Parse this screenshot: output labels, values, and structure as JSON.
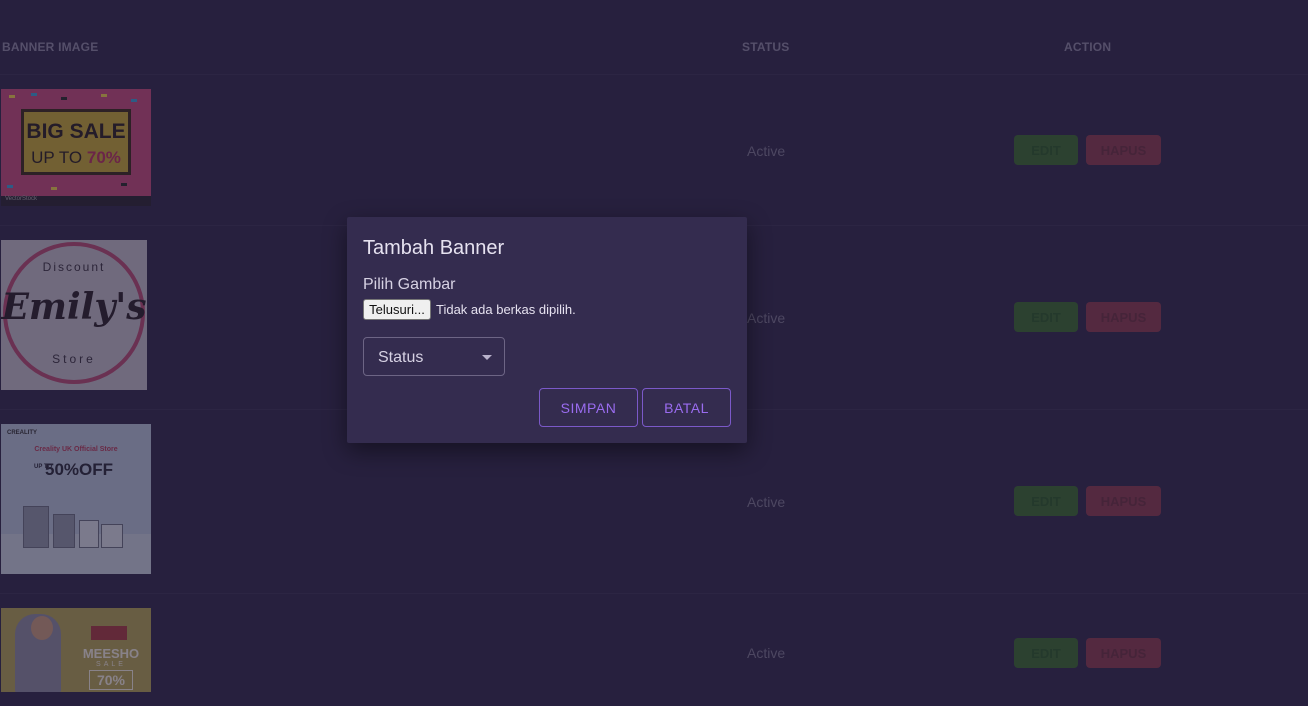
{
  "table": {
    "headers": {
      "image": "BANNER IMAGE",
      "status": "STATUS",
      "action": "ACTION"
    },
    "rows": [
      {
        "status": "Active",
        "edit_label": "EDIT",
        "delete_label": "HAPUS",
        "banner": {
          "title": "BIG SALE",
          "subtitle": "UP TO",
          "discount": "70%",
          "footer": "VectorStock"
        }
      },
      {
        "status": "Active",
        "edit_label": "EDIT",
        "delete_label": "HAPUS",
        "banner": {
          "top": "Discount",
          "name": "Emily's",
          "bottom": "Store"
        }
      },
      {
        "status": "Active",
        "edit_label": "EDIT",
        "delete_label": "HAPUS",
        "banner": {
          "brand": "CREALITY",
          "headline": "Creality UK Official Store",
          "discount": "50%OFF",
          "upto": "UP TO"
        }
      },
      {
        "status": "Active",
        "edit_label": "EDIT",
        "delete_label": "HAPUS",
        "banner": {
          "brand": "MEESHO",
          "sale": "SALE",
          "discount": "70%"
        }
      }
    ]
  },
  "dialog": {
    "title": "Tambah Banner",
    "image_label": "Pilih Gambar",
    "file_button": "Telusuri...",
    "file_status": "Tidak ada berkas dipilih.",
    "status_select": "Status",
    "save_label": "SIMPAN",
    "cancel_label": "BATAL"
  },
  "colors": {
    "background": "#30294a",
    "dialog": "#342c4f",
    "accent": "#9a6cf0",
    "edit": "#3b6a2f",
    "delete": "#8a3a4e"
  }
}
